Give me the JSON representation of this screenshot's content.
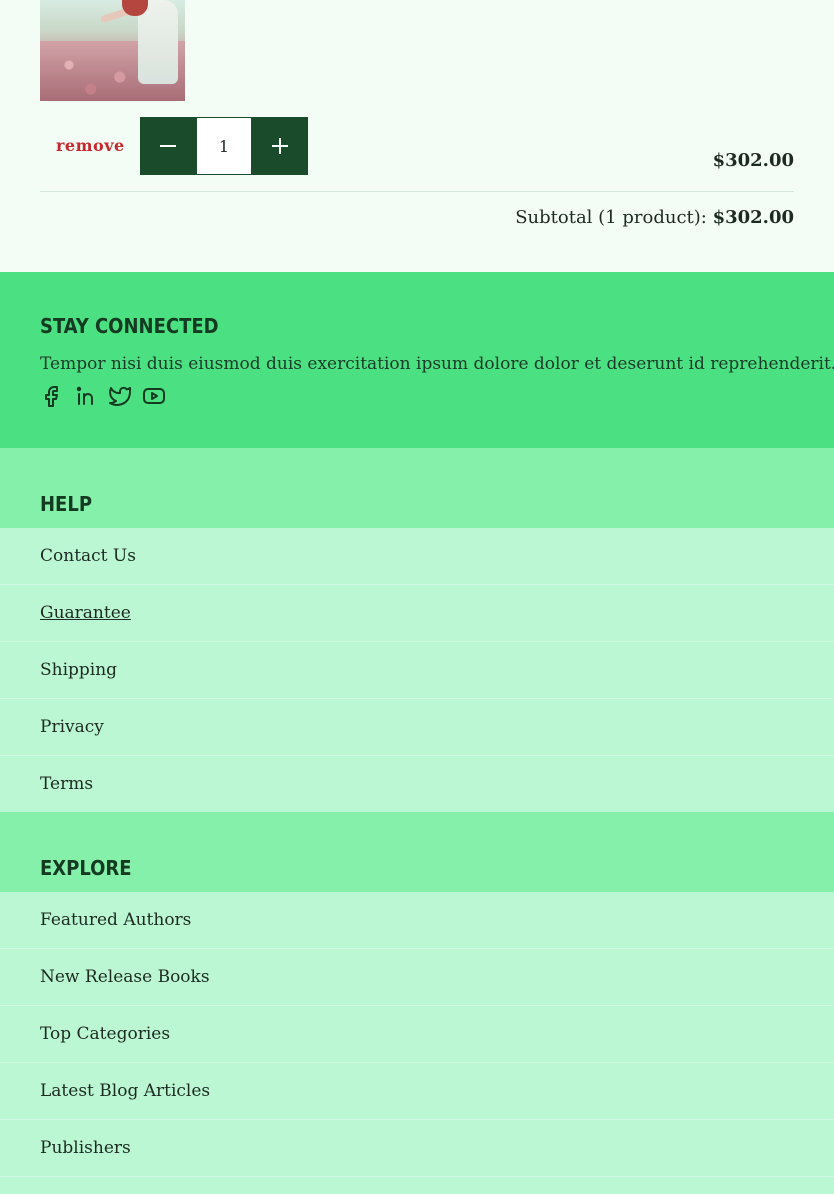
{
  "cart": {
    "remove_label": "remove",
    "quantity": "1",
    "line_price": "$302.00",
    "subtotal_label": "Subtotal (1 product):",
    "subtotal_value": "$302.00"
  },
  "stay_connected": {
    "heading": "Stay Connected",
    "text": "Tempor nisi duis eiusmod duis exercitation ipsum dolore dolor et deserunt id reprehenderit.",
    "social_icons": [
      "facebook-icon",
      "linkedin-icon",
      "twitter-icon",
      "youtube-icon"
    ]
  },
  "help": {
    "heading": "Help",
    "links": [
      "Contact Us",
      "Guarantee",
      "Shipping",
      "Privacy",
      "Terms"
    ]
  },
  "explore": {
    "heading": "Explore",
    "links": [
      "Featured Authors",
      "New Release Books",
      "Top Categories",
      "Latest Blog Articles",
      "Publishers"
    ]
  },
  "colors": {
    "page_bg": "#f3fdf5",
    "connected_bg": "#4be081",
    "group_header_bg": "#85f0aa",
    "link_bg": "#bbf7d2",
    "button_bg": "#1a4c2c",
    "remove_color": "#c5282d"
  }
}
